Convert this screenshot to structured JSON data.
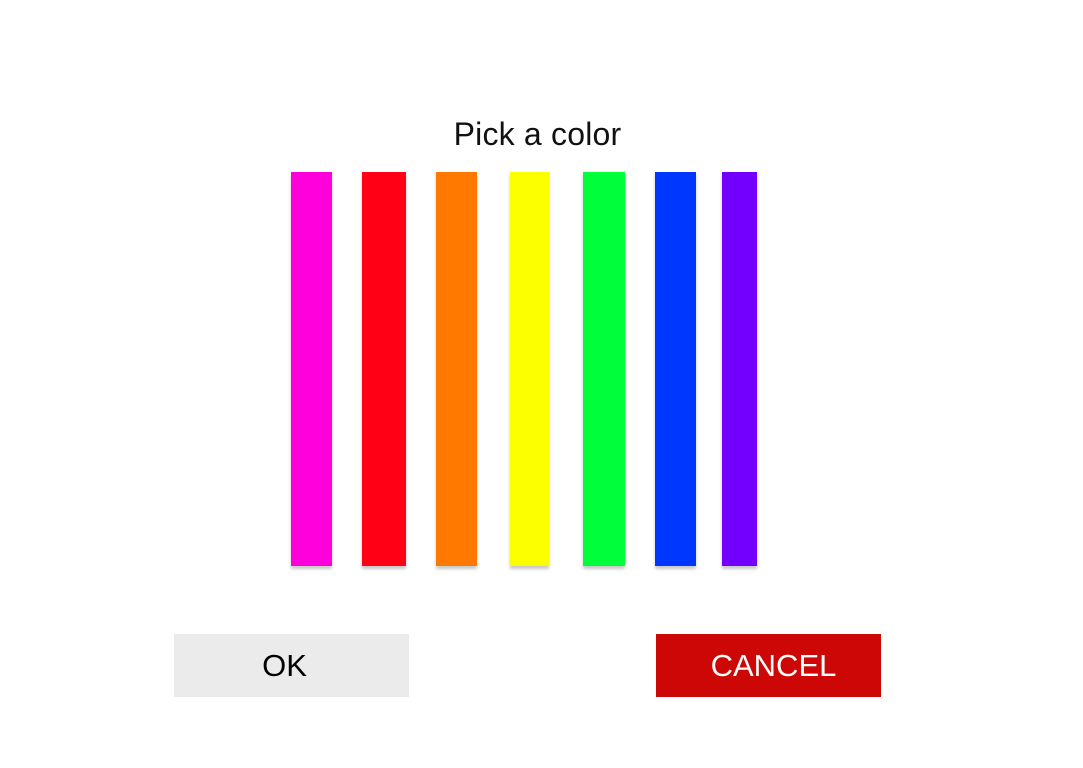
{
  "dialog": {
    "title": "Pick a color",
    "swatches": [
      {
        "name": "magenta",
        "color": "#ff00dd"
      },
      {
        "name": "red",
        "color": "#ff0015"
      },
      {
        "name": "orange",
        "color": "#ff7900"
      },
      {
        "name": "yellow",
        "color": "#fbff00"
      },
      {
        "name": "green",
        "color": "#00ff3a"
      },
      {
        "name": "blue",
        "color": "#0037ff"
      },
      {
        "name": "violet",
        "color": "#7300ff"
      }
    ],
    "ok_label": "OK",
    "cancel_label": "CANCEL",
    "ok_bg": "#ebebeb",
    "cancel_bg": "#cd0606"
  }
}
